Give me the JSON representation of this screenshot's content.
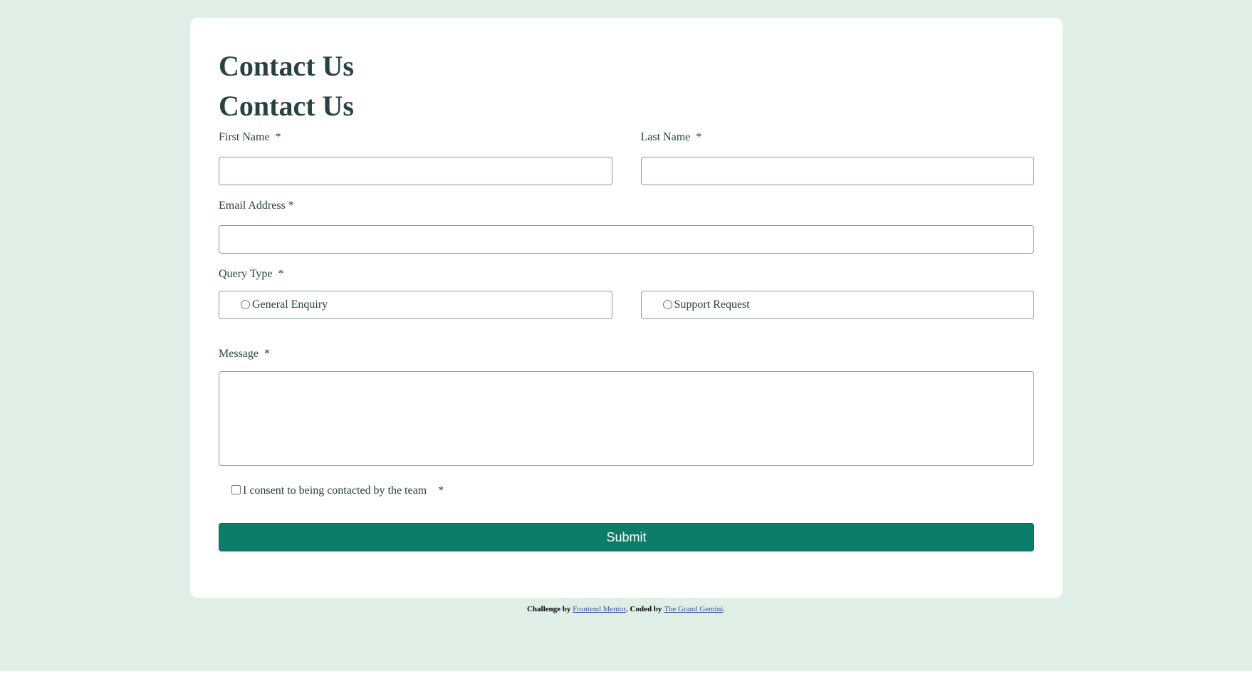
{
  "page": {
    "background_color": "#dfefe5",
    "card_color": "#ffffff",
    "accent_color": "#0c7d69",
    "text_color": "#2a4144"
  },
  "form": {
    "title_1": "Contact Us",
    "title_2": "Contact Us",
    "first_name_label": "First Name  *",
    "first_name_value": "",
    "last_name_label": "Last Name  *",
    "last_name_value": "",
    "email_label": "Email Address *",
    "email_value": "",
    "query_type_label": "Query Type  *",
    "query_options": [
      {
        "label": "General Enquiry",
        "selected": false
      },
      {
        "label": "Support Request",
        "selected": false
      }
    ],
    "message_label": "Message  *",
    "message_value": "",
    "consent_label": "I consent to being contacted by the team    *",
    "consent_checked": false,
    "submit_label": "Submit"
  },
  "attribution": {
    "prefix": "Challenge by ",
    "link1": "Frontend Mentor",
    "middle": ". Coded by ",
    "link2": "The Grand Gemini",
    "suffix": "."
  }
}
